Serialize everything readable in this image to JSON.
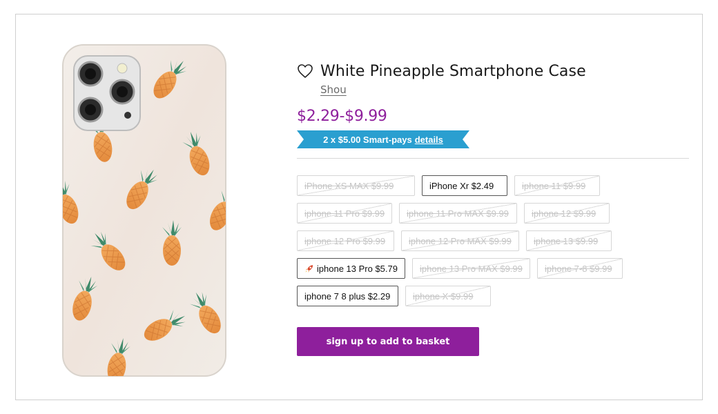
{
  "product": {
    "title": "White Pineapple Smartphone Case",
    "vendor": "Shou",
    "price": "$2.29-$9.99",
    "favorite_icon": "heart-outline-icon",
    "image_alt_icon": "phone-case-image"
  },
  "smartpay": {
    "text": "2 x $5.00 Smart-pays",
    "link": "details",
    "color": "#2a9fd0"
  },
  "variants": [
    {
      "label": "iPhone XS MAX $9.99",
      "available": false
    },
    {
      "label": "iPhone Xr $2.49",
      "available": true
    },
    {
      "label": "iphone 11 $9.99",
      "available": false
    },
    {
      "label": "iphone 11 Pro $9.99",
      "available": false
    },
    {
      "label": "iphone 11 Pro MAX $9.99",
      "available": false
    },
    {
      "label": "iphone 12 $9.99",
      "available": false
    },
    {
      "label": "iphone 12 Pro $9.99",
      "available": false
    },
    {
      "label": "iphone 12 Pro MAX $9.99",
      "available": false
    },
    {
      "label": "iphone 13 $9.99",
      "available": false
    },
    {
      "label": "iphone 13 Pro $5.79",
      "available": true,
      "icon": "rocket-icon"
    },
    {
      "label": "iphone 13 Pro MAX $9.99",
      "available": false
    },
    {
      "label": "iphone 7-8 $9.99",
      "available": false
    },
    {
      "label": "iphone 7 8 plus $2.29",
      "available": true
    },
    {
      "label": "iphone X $9.99",
      "available": false
    }
  ],
  "cta": {
    "label": "sign up to add to basket",
    "color": "#8e1f9c"
  },
  "colors": {
    "price": "#8e1f9c",
    "accent": "#8e1f9c",
    "smartpay": "#2a9fd0"
  }
}
